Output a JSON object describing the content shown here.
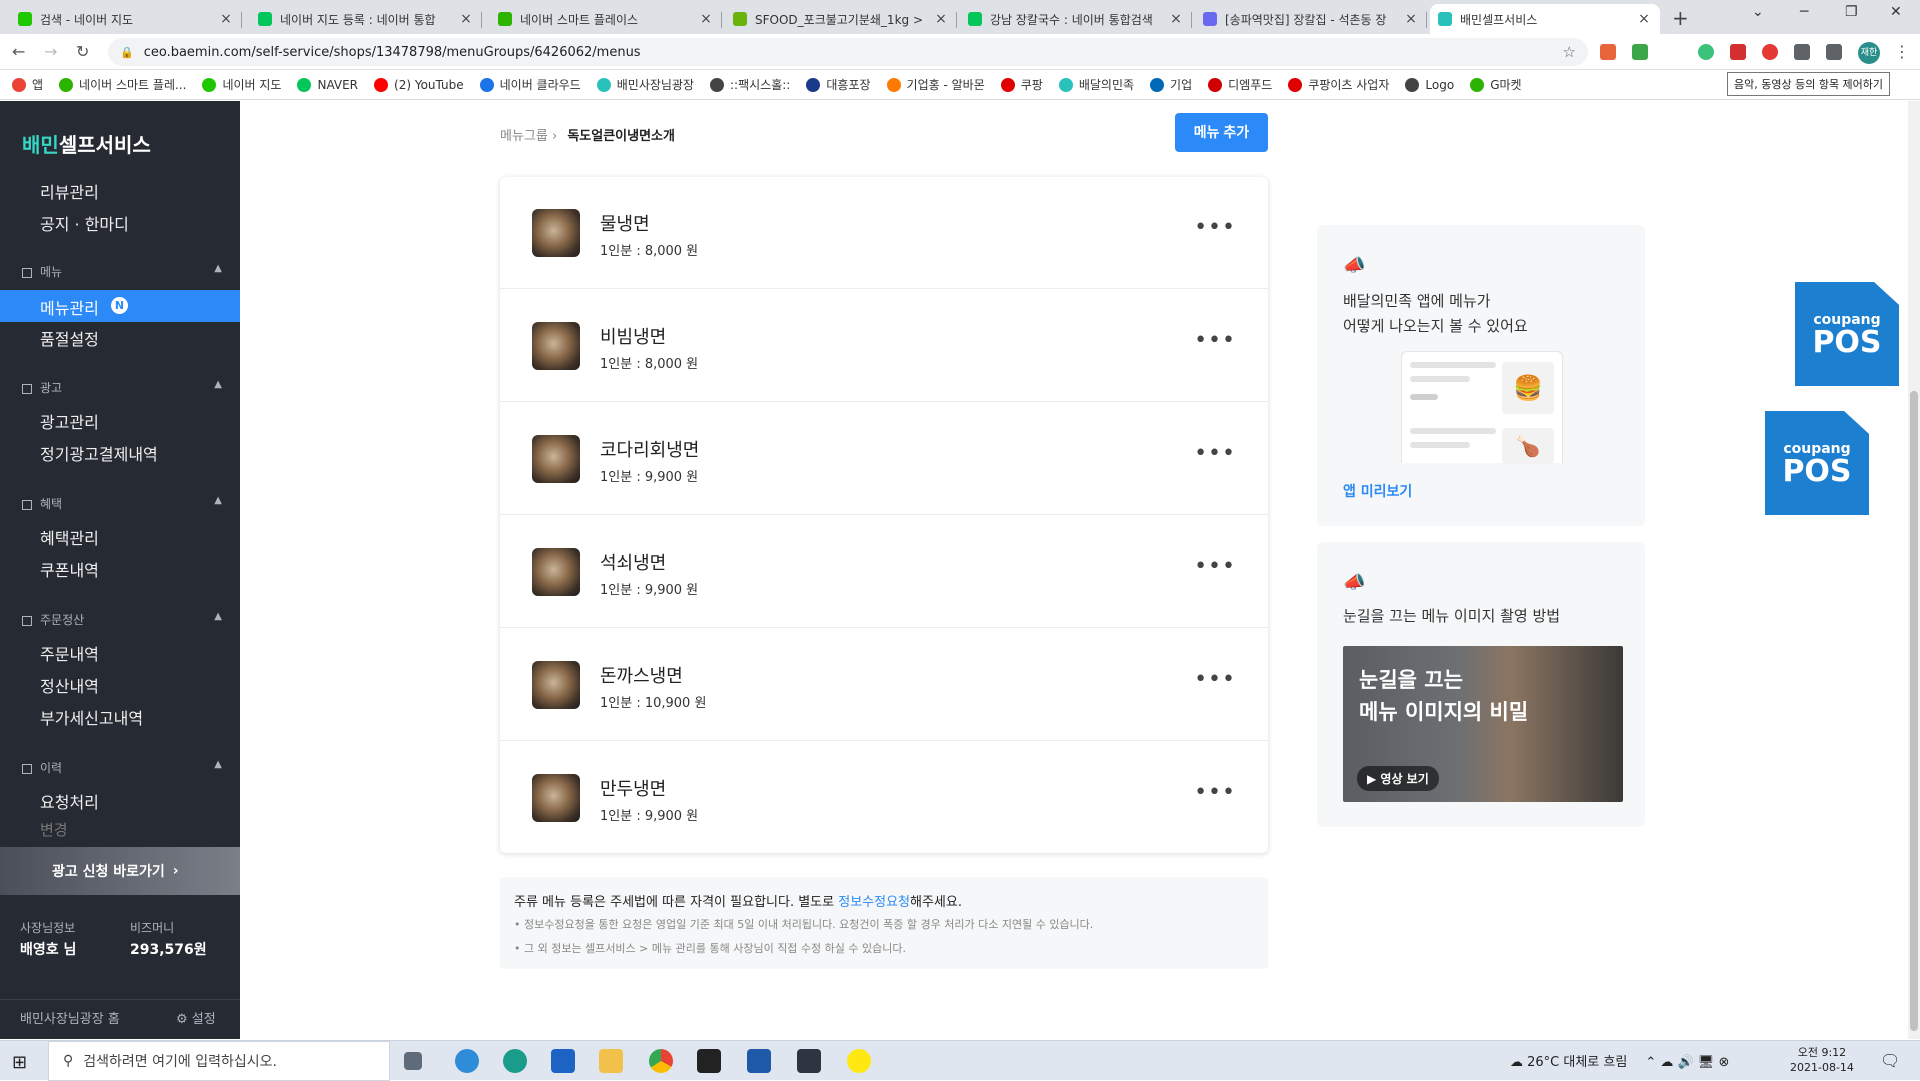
{
  "browser": {
    "tabs": [
      {
        "title": "검색 - 네이버 지도",
        "fav_color": "#1ec800"
      },
      {
        "title": "네이버 지도 등록 : 네이버 통합",
        "fav_color": "#03c75a"
      },
      {
        "title": "네이버 스마트 플레이스",
        "fav_color": "#2db400"
      },
      {
        "title": "SFOOD_포크불고기분쇄_1kg >",
        "fav_color": "#69b30a"
      },
      {
        "title": "강남 장칼국수 : 네이버 통합검색",
        "fav_color": "#03c75a"
      },
      {
        "title": "[송파역맛집] 장칼집 - 석촌동 장",
        "fav_color": "#6a6af0"
      },
      {
        "title": "배민셀프서비스",
        "fav_color": "#2ac1bc"
      }
    ],
    "url": "ceo.baemin.com/self-service/shops/13478798/menuGroups/6426062/menus",
    "bookmarks": [
      "앱",
      "네이버 스마트 플레...",
      "네이버 지도",
      "NAVER",
      "(2) YouTube",
      "네이버 클라우드",
      "배민사장님광장",
      "::팩시스홀::",
      "대흥포장",
      "기업홍 - 알바몬",
      "쿠팡",
      "배달의민족",
      "기업",
      "디엠푸드",
      "쿠팡이츠 사업자",
      "Logo",
      "G마켓"
    ],
    "bookmark_colors": [
      "#ea4335",
      "#2db400",
      "#1ec800",
      "#03c75a",
      "#ff0000",
      "#1a73e8",
      "#2ac1bc",
      "#444444",
      "#1a3a8a",
      "#ff7a00",
      "#e00000",
      "#2ac1bc",
      "#0068b7",
      "#d00000",
      "#e00000",
      "#444444",
      "#2db400"
    ],
    "tooltip": "음악, 동영상 등의 항목 제어하기",
    "profile": "재한"
  },
  "sidebar": {
    "logo_brand": "배민",
    "logo_rest": "셀프서비스",
    "top_items": [
      "리뷰관리",
      "공지 · 한마디"
    ],
    "sections": [
      {
        "title": "메뉴",
        "items": [
          "메뉴관리",
          "품절설정"
        ]
      },
      {
        "title": "광고",
        "items": [
          "광고관리",
          "정기광고결제내역"
        ]
      },
      {
        "title": "혜택",
        "items": [
          "혜택관리",
          "쿠폰내역"
        ]
      },
      {
        "title": "주문정산",
        "items": [
          "주문내역",
          "정산내역",
          "부가세신고내역"
        ]
      },
      {
        "title": "이력",
        "items": [
          "요청처리",
          "변경"
        ]
      }
    ],
    "new_badge": "N",
    "ad_banner": "광고 신청 바로가기",
    "owner_label": "사장님정보",
    "owner_value": "배영호 님",
    "bizmoney_label": "비즈머니",
    "bizmoney_value": "293,576원",
    "footer_home": "배민사장님광장 홈",
    "footer_settings": "설정"
  },
  "main": {
    "breadcrumb_root": "메뉴그룹",
    "breadcrumb_current": "독도얼큰이냉면소개",
    "add_menu_label": "메뉴 추가",
    "menus": [
      {
        "name": "물냉면",
        "price": "1인분 : 8,000 원"
      },
      {
        "name": "비빔냉면",
        "price": "1인분 : 8,000 원"
      },
      {
        "name": "코다리회냉면",
        "price": "1인분 : 9,900 원"
      },
      {
        "name": "석쇠냉면",
        "price": "1인분 : 9,900 원"
      },
      {
        "name": "돈까스냉면",
        "price": "1인분 : 10,900 원"
      },
      {
        "name": "만두냉면",
        "price": "1인분 : 9,900 원"
      }
    ],
    "notice_pre": "주류 메뉴 등록은 주세법에 따른 자격이 필요합니다. 별도로 ",
    "notice_link": "정보수정요청",
    "notice_post": "해주세요.",
    "notice_line2": "• 정보수정요청을 통한 요청은 영업일 기준 최대 5일 이내 처리됩니다. 요청건이 폭증 할 경우 처리가 다소 지연될 수 있습니다.",
    "notice_line3": "• 그 외 정보는 셀프서비스 > 메뉴 관리를 통해 사장님이 직접 수정 하실 수 있습니다."
  },
  "side_cards": {
    "preview_text_1": "배달의민족 앱에 메뉴가",
    "preview_text_2": "어떻게 나오는지 볼 수 있어요",
    "preview_link": "앱 미리보기",
    "video_text": "눈길을 끄는 메뉴 이미지 촬영 방법",
    "video_title_1": "눈길을 끄는",
    "video_title_2": "메뉴 이미지의 비밀",
    "video_play": "▶ 영상 보기"
  },
  "pos_widget": {
    "line1": "coupang",
    "line2": "POS"
  },
  "taskbar": {
    "search_placeholder": "검색하려면 여기에 입력하십시오.",
    "weather": "26°C  대체로 흐림",
    "time": "오전 9:12",
    "date": "2021-08-14"
  }
}
